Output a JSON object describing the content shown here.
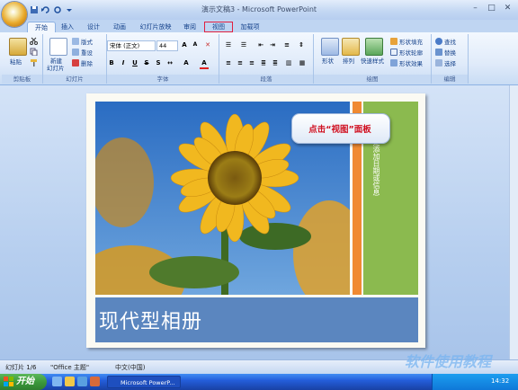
{
  "window": {
    "title": "演示文稿3 - Microsoft PowerPoint",
    "min": "–",
    "max": "□",
    "close": "✕"
  },
  "tabs": [
    {
      "label": "开始",
      "active": true
    },
    {
      "label": "插入"
    },
    {
      "label": "设计"
    },
    {
      "label": "动画"
    },
    {
      "label": "幻灯片放映"
    },
    {
      "label": "审阅"
    },
    {
      "label": "视图",
      "highlighted": true
    },
    {
      "label": "加载项"
    }
  ],
  "ribbon": {
    "groups": {
      "clipboard": "剪贴板",
      "slides": "幻灯片",
      "font": "字体",
      "paragraph": "段落",
      "drawing": "绘图",
      "editing": "编辑"
    },
    "paste": "粘贴",
    "new_slide": "新建\n幻灯片",
    "new_slide_1": "新建",
    "new_slide_2": "幻灯片",
    "layout": "版式",
    "reset": "重设",
    "delete": "删除",
    "font_name": "宋体 (正文)",
    "font_size": "44",
    "shape": "形状",
    "arrange": "排列",
    "quick_style": "快速样式",
    "shape_fill": "形状填充",
    "shape_outline": "形状轮廓",
    "shape_effects": "形状效果",
    "find": "查找",
    "replace": "替换",
    "select": "选择"
  },
  "slide": {
    "title": "现代型相册",
    "side_text": "单击此处添加日期或信息",
    "callout": "点击“视图”面板"
  },
  "status": {
    "slide_counter": "幻灯片 1/6",
    "theme": "\"Office 主题\"",
    "language": "中文(中国)"
  },
  "watermark": "软件使用教程",
  "taskbar": {
    "start": "开始",
    "item": "Microsoft PowerP...",
    "time": "14:32"
  },
  "colors": {
    "accent_orange": "#f08a32",
    "accent_green": "#8bba4f",
    "title_band": "#5b86bf",
    "callout_text": "#d01020"
  }
}
